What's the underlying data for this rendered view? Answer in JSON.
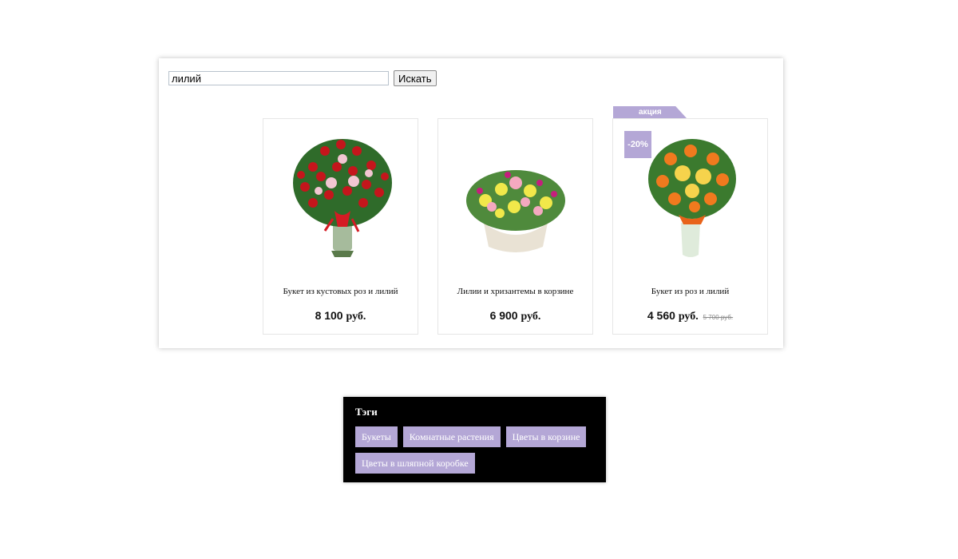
{
  "search": {
    "value": "лилий",
    "button_label": "Искать"
  },
  "products": [
    {
      "name": "Букет из кустовых роз и лилий",
      "price": "8 100",
      "currency": "руб."
    },
    {
      "name": "Лилии и хризантемы в корзине",
      "price": "6 900",
      "currency": "руб."
    },
    {
      "name": "Букет из роз и лилий",
      "price": "4 560",
      "currency": "руб.",
      "old_price": "5 700 руб.",
      "discount": "-20%"
    }
  ],
  "sale_tag": "акция",
  "tags": {
    "title": "Тэги",
    "items": [
      "Букеты",
      "Комнатные растения",
      "Цветы в корзине",
      "Цветы в шляпной коробке"
    ]
  },
  "colors": {
    "accent": "#b4a7d6",
    "tags_background": "#000000"
  }
}
